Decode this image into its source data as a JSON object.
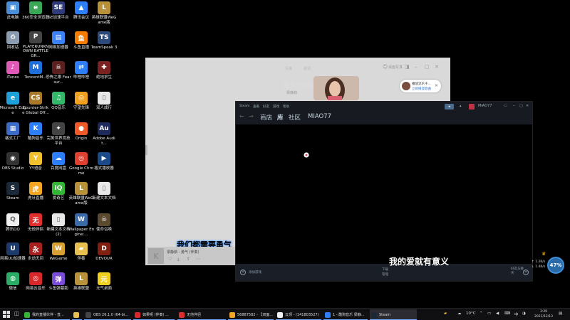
{
  "desktop": {
    "icons": [
      {
        "label": "此电脑",
        "color": "#4a8fd8",
        "glyph": "▣"
      },
      {
        "label": "360安全浏览器",
        "color": "#3aa757",
        "glyph": "e"
      },
      {
        "label": "SE加速平台",
        "color": "#303a7a",
        "glyph": "SE"
      },
      {
        "label": "腾讯会议",
        "color": "#2d7ff9",
        "glyph": "▲"
      },
      {
        "label": "英雄联盟WeGame版",
        "color": "#b8923a",
        "glyph": "L"
      },
      {
        "label": "回收站",
        "color": "#8c9cb0",
        "glyph": "♻"
      },
      {
        "label": "PLAYERUNKNOWN BATTLEGR...",
        "color": "#444",
        "glyph": "P"
      },
      {
        "label": "网络加速器",
        "color": "#3b82f6",
        "glyph": "▤"
      },
      {
        "label": "斗鱼直播",
        "color": "#f57c00",
        "glyph": "鱼"
      },
      {
        "label": "TeamSpeak 3",
        "color": "#2c4a7a",
        "glyph": "TS"
      },
      {
        "label": "iTunes",
        "color": "#e05bb8",
        "glyph": "♪"
      },
      {
        "label": "TencentM...",
        "color": "#1e6fd9",
        "glyph": "M"
      },
      {
        "label": "恐怖之眼 Fear sur...",
        "color": "#5a2020",
        "glyph": "☠"
      },
      {
        "label": "哔哩哔哩",
        "color": "#2d7ff9",
        "glyph": "⇄"
      },
      {
        "label": "绝地求生",
        "color": "#7a2222",
        "glyph": "✚"
      },
      {
        "label": "Microsoft Edge",
        "color": "#1fa0d8",
        "glyph": "e"
      },
      {
        "label": "Counter-Strike Global Off...",
        "color": "#a87a2a",
        "glyph": "CS"
      },
      {
        "label": "QQ音乐",
        "color": "#33b86a",
        "glyph": "♫"
      },
      {
        "label": "守望先锋",
        "color": "#f2a020",
        "glyph": "◎"
      },
      {
        "label": "双人成行",
        "color": "#e8e8e8",
        "glyph": "▯"
      },
      {
        "label": "格式工厂",
        "color": "#3c6cc8",
        "glyph": "▦"
      },
      {
        "label": "酷狗音乐",
        "color": "#2d7ff9",
        "glyph": "K"
      },
      {
        "label": "完美世界竞技平台",
        "color": "#444",
        "glyph": "✦"
      },
      {
        "label": "Origin",
        "color": "#f05a28",
        "glyph": "●"
      },
      {
        "label": "Adobe Audit...",
        "color": "#1f2a5c",
        "glyph": "Au"
      },
      {
        "label": "OBS Studio",
        "color": "#333",
        "glyph": "◉"
      },
      {
        "label": "YY语音",
        "color": "#f2c12e",
        "glyph": "Y"
      },
      {
        "label": "百度网盘",
        "color": "#2d7ff9",
        "glyph": "☁"
      },
      {
        "label": "Google Chrome",
        "color": "#e0402f",
        "glyph": "◎"
      },
      {
        "label": "格式播放器",
        "color": "#1a4a8a",
        "glyph": "▶"
      },
      {
        "label": "Steam",
        "color": "#1b2838",
        "glyph": "S"
      },
      {
        "label": "虎牙直播",
        "color": "#f5a623",
        "glyph": "虎"
      },
      {
        "label": "爱奇艺",
        "color": "#35b535",
        "glyph": "iQ"
      },
      {
        "label": "英雄联盟WeGame版",
        "color": "#b8923a",
        "glyph": "L"
      },
      {
        "label": "新建文本文档",
        "color": "#e8e8e8",
        "glyph": "▯"
      },
      {
        "label": "腾讯QQ",
        "color": "#f0f0f0",
        "glyph": "Q"
      },
      {
        "label": "无他伴侣",
        "color": "#e02d2d",
        "glyph": "无"
      },
      {
        "label": "新建文本文档 (2)",
        "color": "#e8e8e8",
        "glyph": "▯"
      },
      {
        "label": "Wallpaper Engine:...",
        "color": "#3a6aa8",
        "glyph": "W"
      },
      {
        "label": "使命召唤",
        "color": "#5a4a30",
        "glyph": "☠"
      },
      {
        "label": "网易UU加速器",
        "color": "#1e3a6a",
        "glyph": "U"
      },
      {
        "label": "永劫无间",
        "color": "#a82020",
        "glyph": "永"
      },
      {
        "label": "WeGame",
        "color": "#d8a030",
        "glyph": "W"
      },
      {
        "label": "伴奏",
        "color": "#e8c050",
        "glyph": "▰"
      },
      {
        "label": "DEVOUR",
        "color": "#802010",
        "glyph": "D"
      },
      {
        "label": "微信",
        "color": "#2aae67",
        "glyph": "◍"
      },
      {
        "label": "网易云音乐",
        "color": "#d8282a",
        "glyph": "◎"
      },
      {
        "label": "斗鱼弹幕助",
        "color": "#7a4ad8",
        "glyph": "弹"
      },
      {
        "label": "英雄联盟",
        "color": "#b8923a",
        "glyph": "L"
      },
      {
        "label": "元气桌面",
        "color": "#f0d020",
        "glyph": "元"
      }
    ]
  },
  "music": {
    "tabs": [
      "写真",
      "歌词"
    ],
    "song_title": "勇气(伴奏)",
    "song_artist": "梁静茹",
    "popup": {
      "line1": "播放流水千...",
      "line2": "立即播放歌曲"
    },
    "lyric": "我们都需要勇气",
    "mini_title": "梁静茹 - 勇气 (伴奏)"
  },
  "steam": {
    "menus": [
      "Steam",
      "查看",
      "好友",
      "游戏",
      "帮助"
    ],
    "nav": {
      "store": "商店",
      "library": "库",
      "community": "社区",
      "user": "MIAO77"
    },
    "username_top": "MIAO77",
    "bottom": {
      "add_game": "添加游戏",
      "downloads": "下载",
      "downloads_sub": "管理",
      "friends": "好友与聊天"
    }
  },
  "overlay_lyric": "我的爱就有意义",
  "speed_widget": {
    "up": "1.2K/s",
    "down": "1.4K/s",
    "percent": "47%"
  },
  "taskbar": {
    "buttons": [
      {
        "label": "我的直播伙伴 - 直...",
        "color": "#35b535"
      },
      {
        "label": "",
        "color": "#e8c050"
      },
      {
        "label": "OBS 26.1.0 (64-bi...",
        "color": "#444"
      },
      {
        "label": "如果呢 (伴奏) ...",
        "color": "#d8282a"
      },
      {
        "label": "无他伴侣",
        "color": "#e02d2d"
      },
      {
        "label": "56887582 - 【双面...",
        "color": "#f5a623"
      },
      {
        "label": "云顶 - (141803527)",
        "color": "#f0f0f0"
      },
      {
        "label": "1 - 酷狗音乐 梁静...",
        "color": "#2d7ff9"
      },
      {
        "label": "Steam",
        "color": "#1b2838"
      }
    ],
    "weather": "10°C",
    "language": "中",
    "time": "3:29",
    "date": "2021/12/13"
  }
}
